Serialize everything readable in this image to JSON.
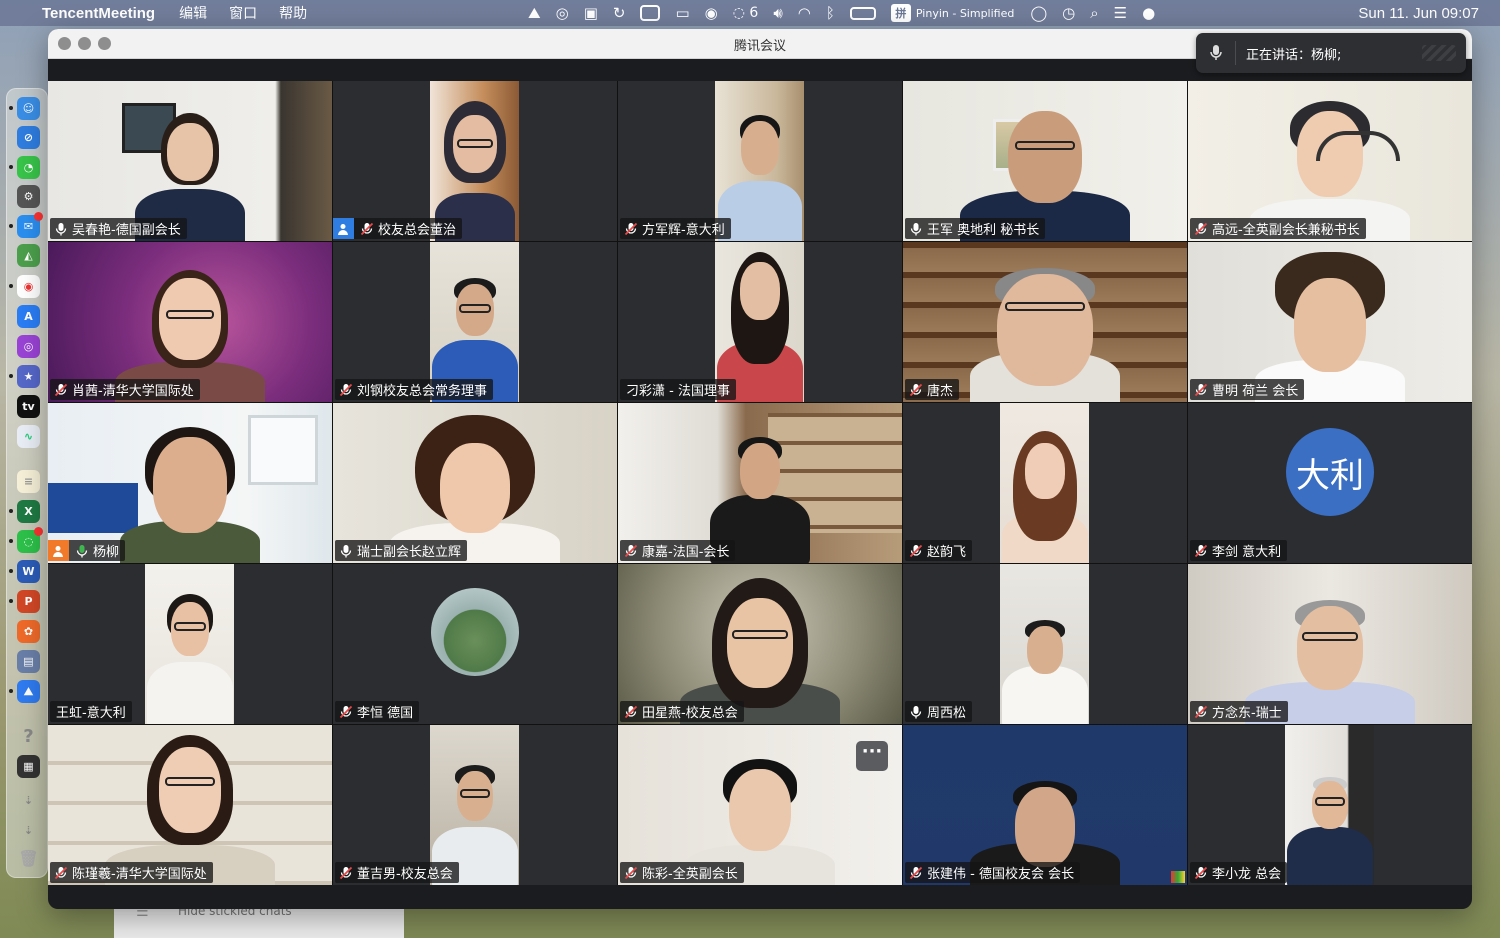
{
  "menubar": {
    "app_name": "TencentMeeting",
    "menu_items": [
      "编辑",
      "窗口",
      "帮助"
    ],
    "wechat_count": "6",
    "ime_label": "Pinyin - Simplified",
    "ime_glyph": "拼",
    "clock": "Sun 11. Jun  09:07"
  },
  "window": {
    "title": "腾讯会议",
    "speaking_label": "正在讲话：杨柳;"
  },
  "participants": [
    {
      "name": "吴春艳-德国副会长",
      "mic": "on",
      "active": false
    },
    {
      "name": "校友总会董治",
      "mic": "muted",
      "host": true,
      "active": false
    },
    {
      "name": "方军辉-意大利",
      "mic": "muted",
      "active": false
    },
    {
      "name": "王军 奥地利 秘书长",
      "mic": "on",
      "active": false
    },
    {
      "name": "高远-全英副会长兼秘书长",
      "mic": "muted",
      "active": false
    },
    {
      "name": "肖茜-清华大学国际处",
      "mic": "muted",
      "active": false
    },
    {
      "name": "刘钢校友总会常务理事",
      "mic": "muted",
      "active": false
    },
    {
      "name": "刁彩潇 - 法国理事",
      "mic": "none",
      "active": false
    },
    {
      "name": "唐杰",
      "mic": "muted",
      "active": false
    },
    {
      "name": "曹明 荷兰 会长",
      "mic": "muted",
      "active": false
    },
    {
      "name": "杨柳",
      "mic": "speaking",
      "cohost": true,
      "active": true
    },
    {
      "name": "瑞士副会长赵立辉",
      "mic": "on",
      "active": false
    },
    {
      "name": "康嘉-法国-会长",
      "mic": "muted",
      "active": false
    },
    {
      "name": "赵韵飞",
      "mic": "muted",
      "active": false
    },
    {
      "name": "李剑 意大利",
      "mic": "muted",
      "avatar_text": "大利",
      "active": false
    },
    {
      "name": "王虹-意大利",
      "mic": "none",
      "active": false
    },
    {
      "name": "李恒 德国",
      "mic": "muted",
      "active": false
    },
    {
      "name": "田星燕-校友总会",
      "mic": "muted",
      "active": false
    },
    {
      "name": "周西松",
      "mic": "on",
      "active": false
    },
    {
      "name": "方念东-瑞士",
      "mic": "muted",
      "active": false
    },
    {
      "name": "陈瑾羲-清华大学国际处",
      "mic": "muted",
      "active": false
    },
    {
      "name": "董吉男-校友总会",
      "mic": "muted",
      "active": false
    },
    {
      "name": "陈彩-全英副会长",
      "mic": "muted",
      "active": false
    },
    {
      "name": "张建伟 - 德国校友会 会长",
      "mic": "muted",
      "active": false
    },
    {
      "name": "李小龙 总会",
      "mic": "muted",
      "active": false
    }
  ],
  "tile_menu_glyph": "···",
  "background_panel": {
    "hide_chats_label": "Hide stickied chats"
  },
  "colors": {
    "speaking_border": "#3fb650",
    "avatar_bg": "#3b6fc4",
    "muted_mic": "#e84a4a",
    "tile_bg": "#2b2d30"
  }
}
